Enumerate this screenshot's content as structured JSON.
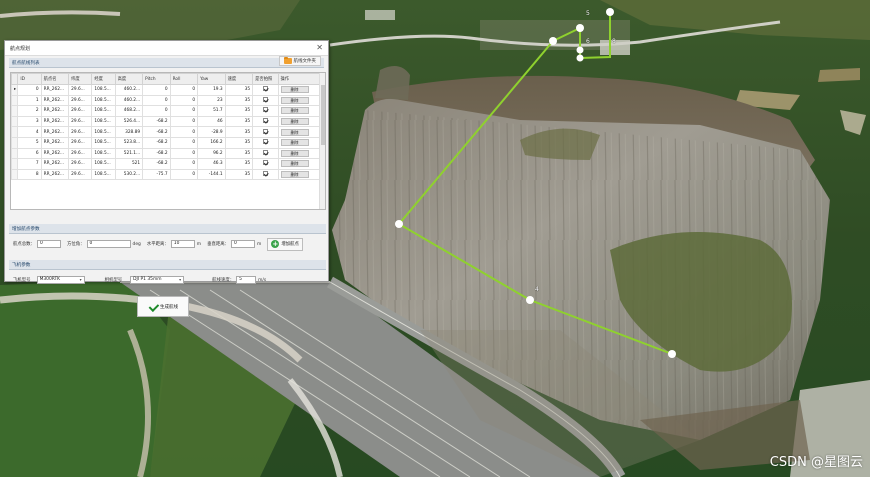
{
  "dialog": {
    "title": "航点规划",
    "close_icon": "close-icon",
    "table_section": {
      "label": "航点航线列表",
      "file_button": "航线文件夹",
      "columns": [
        "ID",
        "航点名",
        "纬度",
        "经度",
        "高度",
        "Pitch",
        "Roll",
        "Yaw",
        "速度",
        "是否拍照",
        "操作"
      ],
      "rows": [
        {
          "id": "0",
          "name": "RR_262...",
          "lat": "29.6...",
          "lng": "108.5...",
          "alt": "460.2...",
          "pitch": "0",
          "roll": "0",
          "yaw": "19.3",
          "speed": "35",
          "photo": "√",
          "op": "删除"
        },
        {
          "id": "1",
          "name": "RR_262...",
          "lat": "29.6...",
          "lng": "108.5...",
          "alt": "460.2...",
          "pitch": "0",
          "roll": "0",
          "yaw": "23",
          "speed": "35",
          "photo": "√",
          "op": "删除"
        },
        {
          "id": "2",
          "name": "RR_262...",
          "lat": "29.6...",
          "lng": "108.5...",
          "alt": "468.2...",
          "pitch": "0",
          "roll": "0",
          "yaw": "51.7",
          "speed": "35",
          "photo": "√",
          "op": "删除"
        },
        {
          "id": "3",
          "name": "RR_262...",
          "lat": "29.6...",
          "lng": "108.5...",
          "alt": "526.4...",
          "pitch": "-68.2",
          "roll": "0",
          "yaw": "46",
          "speed": "35",
          "photo": "√",
          "op": "删除"
        },
        {
          "id": "4",
          "name": "RR_262...",
          "lat": "29.6...",
          "lng": "108.5...",
          "alt": "328.89",
          "pitch": "-68.2",
          "roll": "0",
          "yaw": "-28.9",
          "speed": "35",
          "photo": "√",
          "op": "删除"
        },
        {
          "id": "5",
          "name": "RR_262...",
          "lat": "29.6...",
          "lng": "108.5...",
          "alt": "523.8...",
          "pitch": "-68.2",
          "roll": "0",
          "yaw": "166.2",
          "speed": "35",
          "photo": "√",
          "op": "删除"
        },
        {
          "id": "6",
          "name": "RR_262...",
          "lat": "29.6...",
          "lng": "108.5...",
          "alt": "521.1...",
          "pitch": "-68.2",
          "roll": "0",
          "yaw": "96.2",
          "speed": "35",
          "photo": "√",
          "op": "删除"
        },
        {
          "id": "7",
          "name": "RR_262...",
          "lat": "29.6...",
          "lng": "108.5...",
          "alt": "521",
          "pitch": "-68.2",
          "roll": "0",
          "yaw": "46.3",
          "speed": "35",
          "photo": "√",
          "op": "删除"
        },
        {
          "id": "8",
          "name": "RR_262...",
          "lat": "29.6...",
          "lng": "108.5...",
          "alt": "530.2...",
          "pitch": "-75.7",
          "roll": "0",
          "yaw": "-144.1",
          "speed": "35",
          "photo": "√",
          "op": "删除"
        }
      ]
    },
    "add_section": {
      "label": "增加航点参数",
      "fields": [
        {
          "label": "航点总数：",
          "value": "0"
        },
        {
          "label": "方位角：",
          "value": "0"
        },
        {
          "label": "水平距离：",
          "value": "10",
          "unit": "m"
        },
        {
          "label": "垂直距离：",
          "value": "0",
          "unit": "m"
        }
      ],
      "first_unit": "deg",
      "add_button": "增加航点"
    },
    "flight_section": {
      "label": "飞机参数",
      "aircraft_label": "飞机型号",
      "aircraft_value": "M300RTK",
      "camera_label": "相机型号",
      "camera_value": "DJI P1 35mm",
      "speed_label": "航线速度：",
      "speed_value": "5",
      "speed_unit": "m/s"
    },
    "generate_button": "生成航线"
  },
  "scene": {
    "waypoint_labels": [
      "5",
      "6",
      "8",
      "4"
    ],
    "path_color": "#8fd12e"
  },
  "watermark": "CSDN @星图云"
}
